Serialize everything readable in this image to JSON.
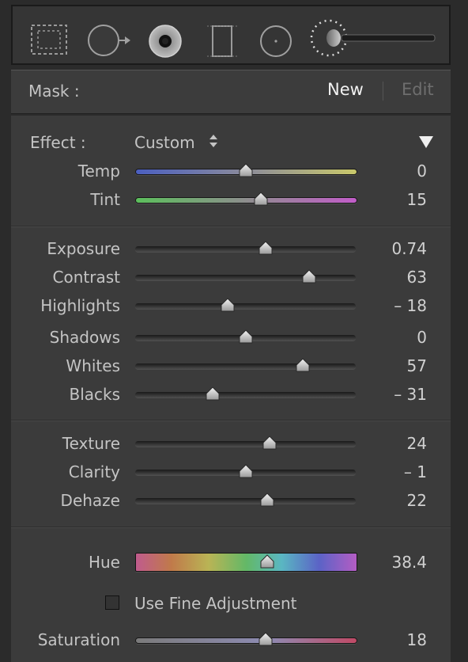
{
  "mask": {
    "label": "Mask :",
    "new": "New",
    "edit": "Edit"
  },
  "effect": {
    "label": "Effect :",
    "value": "Custom"
  },
  "sliders": [
    {
      "label": "Temp",
      "value": "0",
      "position": 0.5,
      "track": "temp"
    },
    {
      "label": "Tint",
      "value": "15",
      "position": 0.57,
      "track": "tint"
    },
    {
      "label": "Exposure",
      "value": "0.74",
      "position": 0.59,
      "track": "gray"
    },
    {
      "label": "Contrast",
      "value": "63",
      "position": 0.79,
      "track": "gray"
    },
    {
      "label": "Highlights",
      "value": "– 18",
      "position": 0.42,
      "track": "gray"
    },
    {
      "label": "Shadows",
      "value": "0",
      "position": 0.5,
      "track": "gray"
    },
    {
      "label": "Whites",
      "value": "57",
      "position": 0.76,
      "track": "gray"
    },
    {
      "label": "Blacks",
      "value": "– 31",
      "position": 0.35,
      "track": "gray"
    },
    {
      "label": "Texture",
      "value": "24",
      "position": 0.61,
      "track": "gray"
    },
    {
      "label": "Clarity",
      "value": "– 1",
      "position": 0.5,
      "track": "gray"
    },
    {
      "label": "Dehaze",
      "value": "22",
      "position": 0.6,
      "track": "gray"
    },
    {
      "label": "Hue",
      "value": "38.4",
      "position": 0.6,
      "track": "hue"
    },
    {
      "label": "Saturation",
      "value": "18",
      "position": 0.59,
      "track": "sat"
    }
  ],
  "fine_adjustment": {
    "label": "Use Fine Adjustment",
    "checked": false
  },
  "icons": [
    "graduated-filter-icon",
    "radial-filter-icon",
    "adjustment-brush-icon",
    "range-mask-icon",
    "spot-icon",
    "brush-size-icon"
  ],
  "colors": {
    "panel": "#3b3b3b",
    "background": "#2b2b2b",
    "text": "#c4c4c4"
  }
}
